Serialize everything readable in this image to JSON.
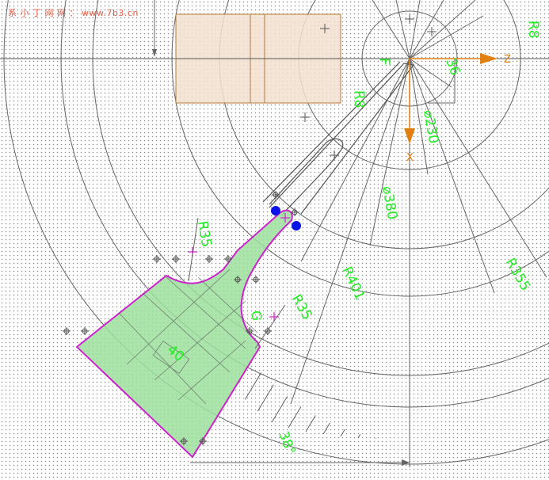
{
  "watermark": "系 小 丁 网 网 ：  www.7b3.cn",
  "labels": {
    "point_f": "F",
    "point_g": "G",
    "axis_z": "Z",
    "axis_x": "X",
    "r8_top": "R8",
    "r8_mid": "R8",
    "dim_36": "36",
    "dia_230": "⌀230",
    "dia_380": "⌀380",
    "r401": "R401",
    "r355": "R355",
    "r35_left": "R35",
    "r35_right": "R35",
    "dim_40": "40",
    "angle_38": "38°"
  },
  "colors": {
    "dimension_text": "#22ee22",
    "profile_outline": "#cc22cc",
    "profile_fill": "#9ee09e",
    "construction": "#555555",
    "axis_marker": "#e08010",
    "grip_point": "#0a14e6",
    "watermark": "#e8604a",
    "clamp_block": "#f3e0d0"
  }
}
